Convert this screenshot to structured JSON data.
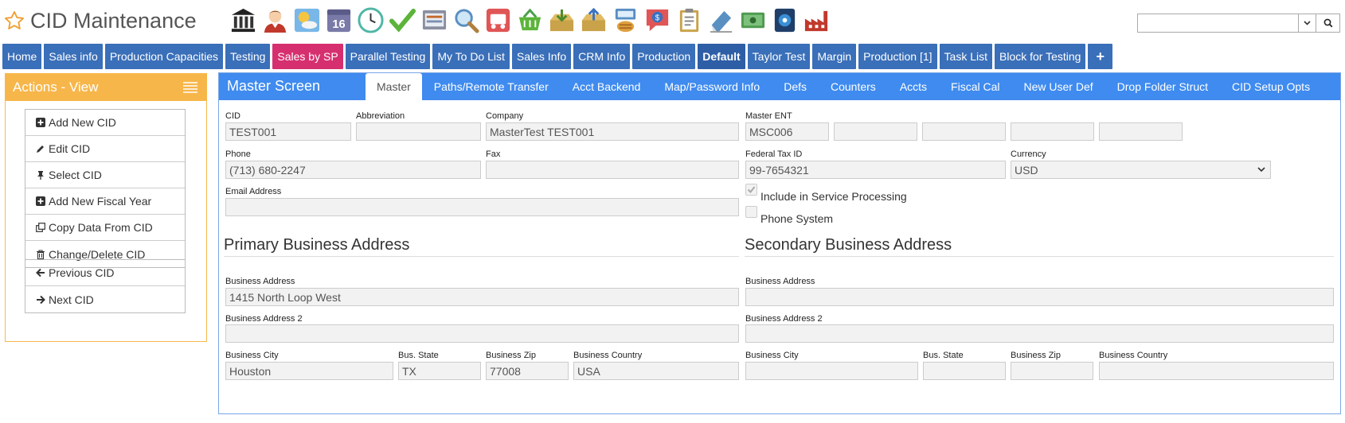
{
  "app": {
    "title": "CID Maintenance"
  },
  "toolbar_icons": [
    "bank-icon",
    "user-icon",
    "weather-icon",
    "calendar-icon",
    "clock-icon",
    "checkmark-icon",
    "screen-icon",
    "magnifier-icon",
    "truck-icon",
    "basket-icon",
    "inbox-download-icon",
    "inbox-upload-icon",
    "server-icon",
    "money-bubble-icon",
    "clipboard-icon",
    "eraser-icon",
    "cash-icon",
    "device-icon",
    "factory-icon"
  ],
  "calendar_day": "16",
  "search": {
    "value": "",
    "placeholder": ""
  },
  "nav": [
    {
      "label": "Home"
    },
    {
      "label": "Sales info"
    },
    {
      "label": "Production Capacities"
    },
    {
      "label": "Testing"
    },
    {
      "label": "Sales by SP",
      "style": "pink"
    },
    {
      "label": "Parallel Testing"
    },
    {
      "label": "My To Do List"
    },
    {
      "label": "Sales Info"
    },
    {
      "label": "CRM Info"
    },
    {
      "label": "Production"
    },
    {
      "label": "Default",
      "style": "dark"
    },
    {
      "label": "Taylor Test"
    },
    {
      "label": "Margin"
    },
    {
      "label": "Production [1]"
    },
    {
      "label": "Task List"
    },
    {
      "label": "Block for Testing"
    },
    {
      "label": "+",
      "style": "plus"
    }
  ],
  "actions": {
    "title": "Actions - View",
    "group1": [
      "Add New CID",
      "Edit CID",
      "Select CID",
      "Add New Fiscal Year",
      "Copy Data From CID",
      "Change/Delete CID"
    ],
    "group2": [
      "Previous CID",
      "Next CID"
    ]
  },
  "main": {
    "title": "Master Screen",
    "tabs": [
      "Master",
      "Paths/Remote Transfer",
      "Acct Backend",
      "Map/Password Info",
      "Defs",
      "Counters",
      "Accts",
      "Fiscal Cal",
      "New User Def",
      "Drop Folder Struct",
      "CID Setup Opts"
    ]
  },
  "form": {
    "cid_label": "CID",
    "cid": "TEST001",
    "abbr_label": "Abbreviation",
    "abbr": "",
    "company_label": "Company",
    "company": "MasterTest TEST001",
    "master_ent_label": "Master ENT",
    "master_ent": [
      "MSC006",
      "",
      "",
      "",
      ""
    ],
    "phone_label": "Phone",
    "phone": "(713) 680-2247",
    "fax_label": "Fax",
    "fax": "",
    "fed_tax_label": "Federal Tax ID",
    "fed_tax": "99-7654321",
    "currency_label": "Currency",
    "currency": "USD",
    "email_label": "Email Address",
    "email": "",
    "include_service": {
      "label": "Include in Service Processing",
      "checked": true
    },
    "phone_system": {
      "label": "Phone System",
      "checked": false
    }
  },
  "primary": {
    "heading": "Primary Business Address",
    "addr_label": "Business Address",
    "addr": "1415 North Loop West",
    "addr2_label": "Business Address 2",
    "addr2": "",
    "city_label": "Business City",
    "city": "Houston",
    "state_label": "Bus. State",
    "state": "TX",
    "zip_label": "Business Zip",
    "zip": "77008",
    "country_label": "Business Country",
    "country": "USA"
  },
  "secondary": {
    "heading": "Secondary Business Address",
    "addr_label": "Business Address",
    "addr": "",
    "addr2_label": "Business Address 2",
    "addr2": "",
    "city_label": "Business City",
    "city": "",
    "state_label": "Bus. State",
    "state": "",
    "zip_label": "Business Zip",
    "zip": "",
    "country_label": "Business Country",
    "country": ""
  }
}
